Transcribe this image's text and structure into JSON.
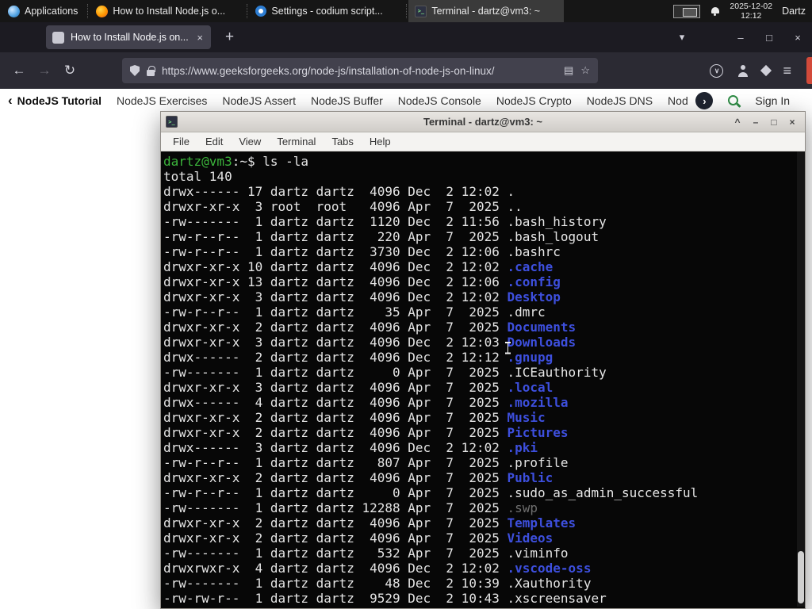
{
  "colors": {
    "term-green": "#3bb33b",
    "dir-blue": "#3d4fdd",
    "dim-gray": "#6e6e6e",
    "gfg-green": "#2f8d46",
    "accent-red": "#d24a3a"
  },
  "glyphs": {
    "prompt_icon": ">_",
    "back": "←",
    "forward": "→",
    "reload": "↻",
    "plus": "+",
    "chevron_down": "▾",
    "minimize": "–",
    "maximize": "□",
    "close": "×",
    "menu": "≡",
    "reader": "▤",
    "star": "☆",
    "shade": "^",
    "chevron_left": "‹",
    "chevron_right": "›",
    "pocket_chevron": "∨"
  },
  "panel": {
    "applications_label": "Applications",
    "tasks": [
      {
        "label": "How to Install Node.js o..."
      },
      {
        "label": "Settings - codium script..."
      },
      {
        "label": "Terminal - dartz@vm3: ~"
      }
    ],
    "clock_date": "2025-12-02",
    "clock_time": "12:12",
    "user": "Dartz"
  },
  "browser": {
    "tab_title": "How to Install Node.js on...",
    "url": "https://www.geeksforgeeks.org/node-js/installation-of-node-js-on-linux/"
  },
  "site_nav": {
    "items": [
      "NodeJS Tutorial",
      "NodeJS Exercises",
      "NodeJS Assert",
      "NodeJS Buffer",
      "NodeJS Console",
      "NodeJS Crypto",
      "NodeJS DNS",
      "Node"
    ],
    "sign_in": "Sign In"
  },
  "terminal": {
    "window_title": "Terminal - dartz@vm3: ~",
    "menu": [
      "File",
      "Edit",
      "View",
      "Terminal",
      "Tabs",
      "Help"
    ],
    "prompt_user": "dartz@vm3",
    "prompt_suffix": ":~$",
    "command": "ls -la",
    "total_line": "total 140",
    "listing": [
      {
        "pre": "drwx------ 17 dartz dartz  4096 Dec  2 12:02 ",
        "name": ".",
        "kind": "file"
      },
      {
        "pre": "drwxr-xr-x  3 root  root   4096 Apr  7  2025 ",
        "name": "..",
        "kind": "file"
      },
      {
        "pre": "-rw-------  1 dartz dartz  1120 Dec  2 11:56 ",
        "name": ".bash_history",
        "kind": "file"
      },
      {
        "pre": "-rw-r--r--  1 dartz dartz   220 Apr  7  2025 ",
        "name": ".bash_logout",
        "kind": "file"
      },
      {
        "pre": "-rw-r--r--  1 dartz dartz  3730 Dec  2 12:06 ",
        "name": ".bashrc",
        "kind": "file"
      },
      {
        "pre": "drwxr-xr-x 10 dartz dartz  4096 Dec  2 12:02 ",
        "name": ".cache",
        "kind": "dir"
      },
      {
        "pre": "drwxr-xr-x 13 dartz dartz  4096 Dec  2 12:06 ",
        "name": ".config",
        "kind": "dir"
      },
      {
        "pre": "drwxr-xr-x  3 dartz dartz  4096 Dec  2 12:02 ",
        "name": "Desktop",
        "kind": "dir"
      },
      {
        "pre": "-rw-r--r--  1 dartz dartz    35 Apr  7  2025 ",
        "name": ".dmrc",
        "kind": "file"
      },
      {
        "pre": "drwxr-xr-x  2 dartz dartz  4096 Apr  7  2025 ",
        "name": "Documents",
        "kind": "dir"
      },
      {
        "pre": "drwxr-xr-x  3 dartz dartz  4096 Dec  2 12:03 ",
        "name": "Downloads",
        "kind": "dir"
      },
      {
        "pre": "drwx------  2 dartz dartz  4096 Dec  2 12:12 ",
        "name": ".gnupg",
        "kind": "dir"
      },
      {
        "pre": "-rw-------  1 dartz dartz     0 Apr  7  2025 ",
        "name": ".ICEauthority",
        "kind": "file"
      },
      {
        "pre": "drwxr-xr-x  3 dartz dartz  4096 Apr  7  2025 ",
        "name": ".local",
        "kind": "dir"
      },
      {
        "pre": "drwx------  4 dartz dartz  4096 Apr  7  2025 ",
        "name": ".mozilla",
        "kind": "dir"
      },
      {
        "pre": "drwxr-xr-x  2 dartz dartz  4096 Apr  7  2025 ",
        "name": "Music",
        "kind": "dir"
      },
      {
        "pre": "drwxr-xr-x  2 dartz dartz  4096 Apr  7  2025 ",
        "name": "Pictures",
        "kind": "dir"
      },
      {
        "pre": "drwx------  3 dartz dartz  4096 Dec  2 12:02 ",
        "name": ".pki",
        "kind": "dir"
      },
      {
        "pre": "-rw-r--r--  1 dartz dartz   807 Apr  7  2025 ",
        "name": ".profile",
        "kind": "file"
      },
      {
        "pre": "drwxr-xr-x  2 dartz dartz  4096 Apr  7  2025 ",
        "name": "Public",
        "kind": "dir"
      },
      {
        "pre": "-rw-r--r--  1 dartz dartz     0 Apr  7  2025 ",
        "name": ".sudo_as_admin_successful",
        "kind": "file"
      },
      {
        "pre": "-rw-------  1 dartz dartz 12288 Apr  7  2025 ",
        "name": ".swp",
        "kind": "dim"
      },
      {
        "pre": "drwxr-xr-x  2 dartz dartz  4096 Apr  7  2025 ",
        "name": "Templates",
        "kind": "dir"
      },
      {
        "pre": "drwxr-xr-x  2 dartz dartz  4096 Apr  7  2025 ",
        "name": "Videos",
        "kind": "dir"
      },
      {
        "pre": "-rw-------  1 dartz dartz   532 Apr  7  2025 ",
        "name": ".viminfo",
        "kind": "file"
      },
      {
        "pre": "drwxrwxr-x  4 dartz dartz  4096 Dec  2 12:02 ",
        "name": ".vscode-oss",
        "kind": "dir"
      },
      {
        "pre": "-rw-------  1 dartz dartz    48 Dec  2 10:39 ",
        "name": ".Xauthority",
        "kind": "file"
      },
      {
        "pre": "-rw-rw-r--  1 dartz dartz  9529 Dec  2 10:43 ",
        "name": ".xscreensaver",
        "kind": "file"
      }
    ]
  }
}
